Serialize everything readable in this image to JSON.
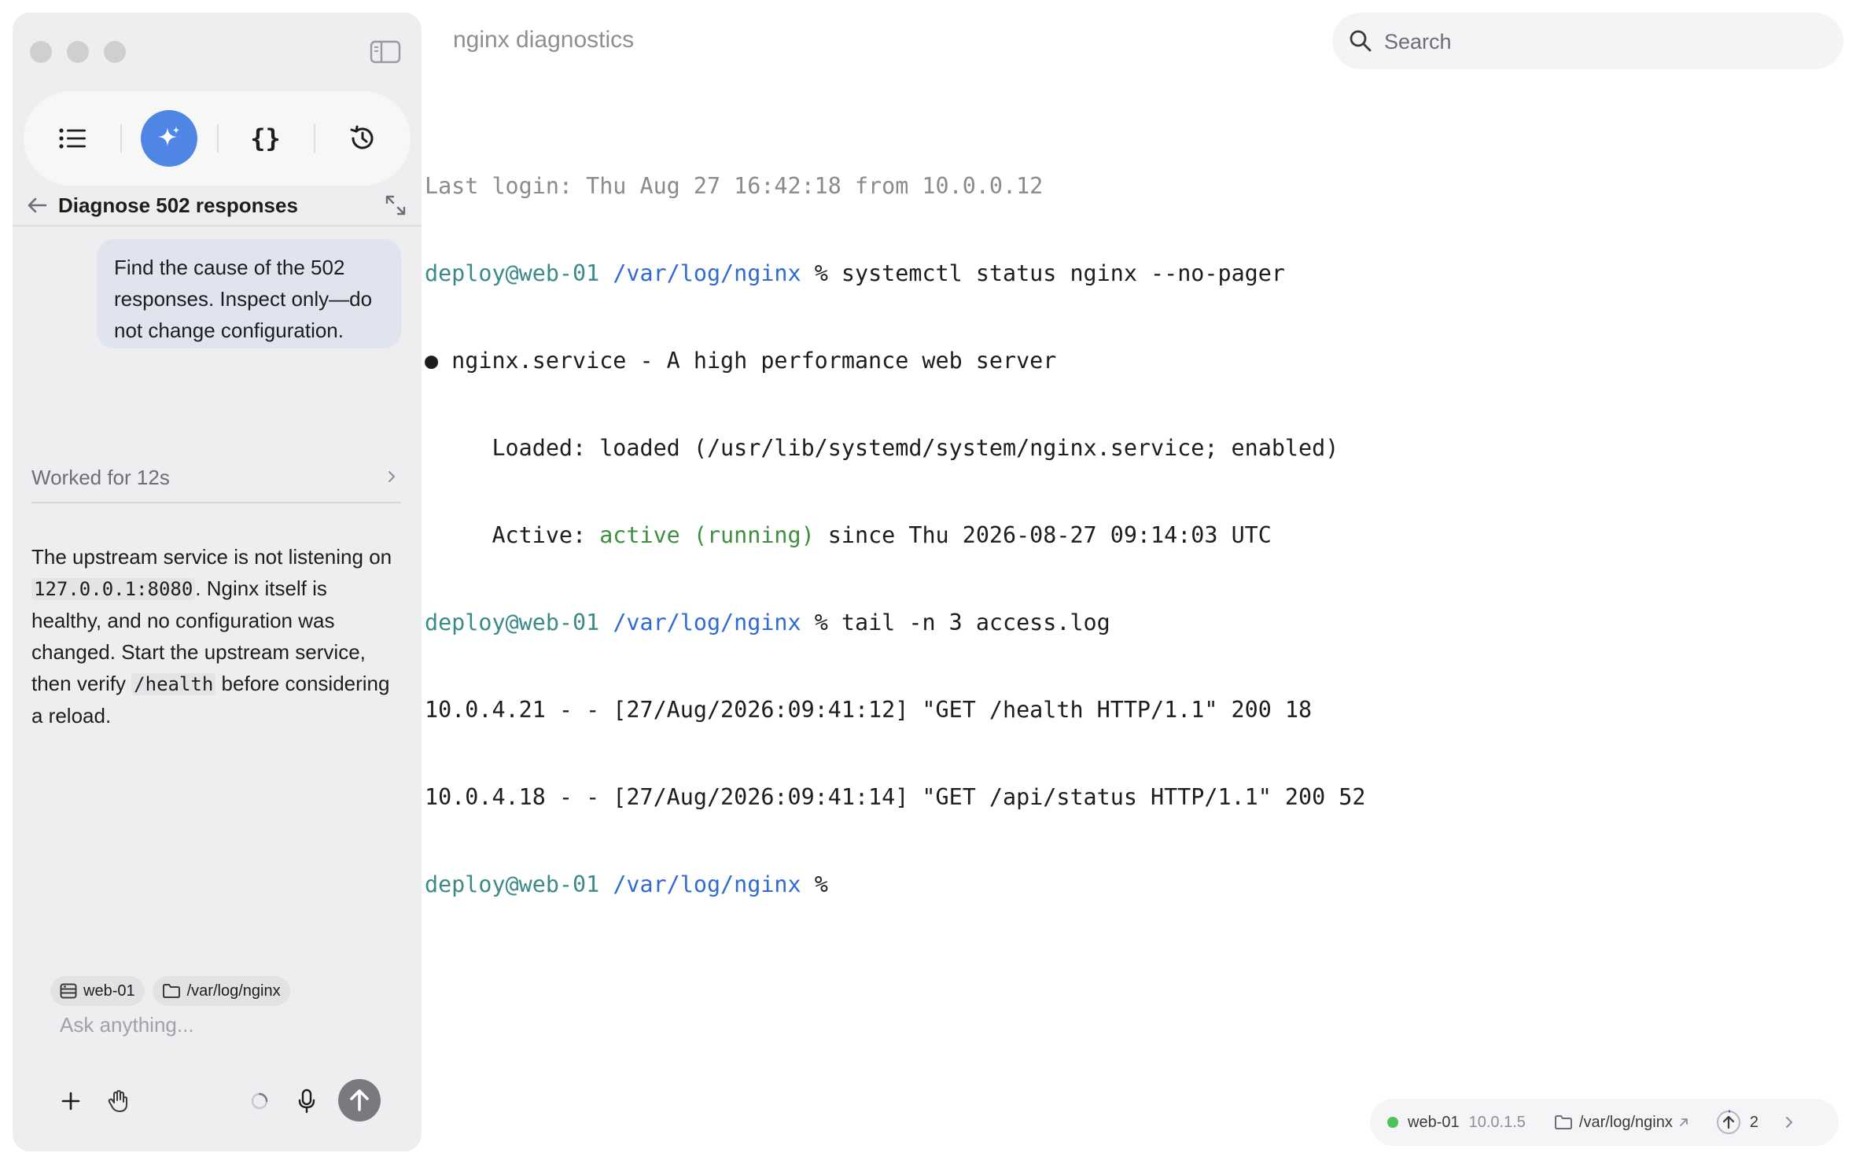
{
  "window": {
    "title": "nginx diagnostics"
  },
  "search": {
    "placeholder": "Search"
  },
  "sidebar": {
    "task": {
      "title": "Diagnose 502 responses"
    },
    "messages": {
      "user": "Find the cause of the 502 responses. Inspect only—do not change configuration.",
      "worked_label": "Worked for 12s",
      "reply": {
        "p1": "The upstream service is not listening on ",
        "code1": "127.0.0.1:8080",
        "p2": ". Nginx itself is healthy, and no configuration was changed. Start the upstream service, then verify ",
        "code2": "/health",
        "p3": " before considering a reload."
      }
    },
    "composer": {
      "chips": {
        "host": "web-01",
        "path": "/var/log/nginx"
      },
      "placeholder": "Ask anything..."
    }
  },
  "terminal": {
    "prompt_user": "deploy@web-01",
    "prompt_path": "/var/log/nginx",
    "prompt_symbol": "%",
    "last_login": "Last login: Thu Aug 27 16:42:18 from 10.0.0.12",
    "cmd1": "systemctl status nginx --no-pager",
    "status_head": "● nginx.service - A high performance web server",
    "loaded": "     Loaded: loaded (/usr/lib/systemd/system/nginx.service; enabled)",
    "active_label": "     Active: ",
    "active_state": "active (running)",
    "active_since": " since Thu 2026-08-27 09:14:03 UTC",
    "cmd2": "tail -n 3 access.log",
    "log": [
      "10.0.4.21 - - [27/Aug/2026:09:41:12] \"GET /health HTTP/1.1\" 200 18",
      "10.0.4.18 - - [27/Aug/2026:09:41:14] \"GET /api/status HTTP/1.1\" 200 52"
    ]
  },
  "status_bar": {
    "host": "web-01",
    "ip": "10.0.1.5",
    "path": "/var/log/nginx",
    "count": "2",
    "status_color": "#4cc25a"
  },
  "colors": {
    "accent": "#4f86e6",
    "prompt_user": "#3a8a8a",
    "prompt_path": "#2f6bd1",
    "active_green": "#3f8f3f"
  }
}
